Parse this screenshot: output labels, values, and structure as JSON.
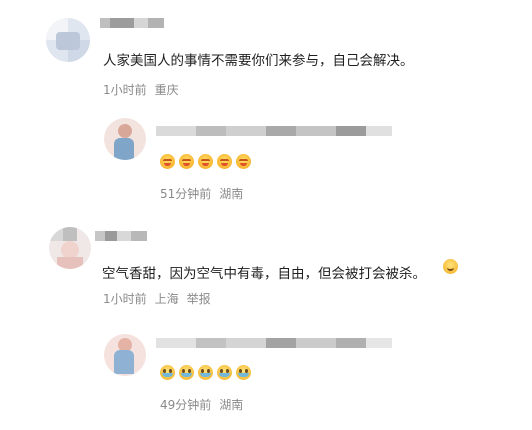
{
  "comments": [
    {
      "text": "人家美国人的事情不需要你们来参与，自己会解决。",
      "time": "1小时前",
      "location": "重庆",
      "reply": {
        "time": "51分钟前",
        "location": "湖南",
        "emoji_icon": "grimace-emoji-icon",
        "emoji_count": 5
      }
    },
    {
      "text": "空气香甜，因为空气中有毒，自由，但会被打会被杀。",
      "trailing_emoji_icon": "smile-emoji-icon",
      "time": "1小时前",
      "location": "上海",
      "report_label": "举报",
      "reply": {
        "time": "49分钟前",
        "location": "湖南",
        "emoji_icon": "teary-emoji-icon",
        "emoji_count": 5
      }
    }
  ]
}
